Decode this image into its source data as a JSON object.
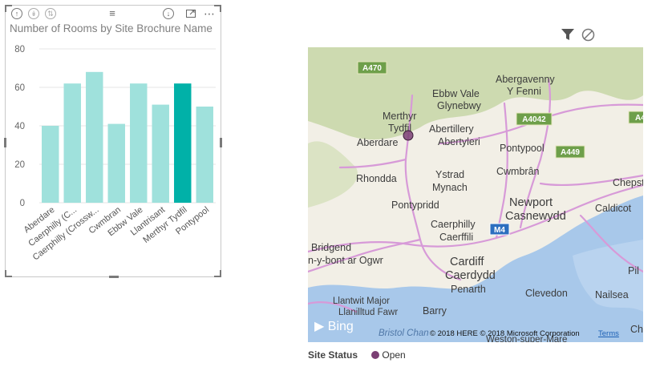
{
  "left_visual": {
    "toolbar_icons": [
      "drill-up-icon",
      "drill-down-all-icon",
      "expand-hierarchy-icon",
      "drag-handle-icon",
      "drill-mode-icon",
      "focus-mode-icon",
      "more-options-icon"
    ],
    "title": "Number of Rooms by Site Brochure Name"
  },
  "chart_data": {
    "type": "bar",
    "title": "Number of Rooms by Site Brochure Name",
    "categories": [
      "Aberdare",
      "Caerphilly (C...",
      "Caerphilly (Crossw...",
      "Cwmbran",
      "Ebbw Vale",
      "Llantrisant",
      "Merthyr Tydfil",
      "Pontypool"
    ],
    "values": [
      40,
      62,
      68,
      41,
      62,
      51,
      62,
      50
    ],
    "highlighted_index": 6,
    "ylim": [
      0,
      80
    ],
    "yticks": [
      0,
      20,
      40,
      60,
      80
    ],
    "grid": true,
    "colors": {
      "bar": "#9fe1dc",
      "highlight": "#01b1a8"
    }
  },
  "map_visual": {
    "header_icons": [
      "filter-icon",
      "blocked-icon"
    ],
    "labels": {
      "a470": "A470",
      "abergavenny": "Abergavenny",
      "y_fenni": "Y Fenni",
      "ebbw_vale": "Ebbw Vale",
      "glynebwy": "Glynebwy",
      "merthyr": "Merthyr",
      "tydfil": "Tydfil",
      "a4042": "A4042",
      "abertillery": "Abertillery",
      "abertyleri": "Abertyleri",
      "aberdare": "Aberdare",
      "pontypool": "Pontypool",
      "a449": "A449",
      "a4_partial": "A4",
      "rhondda": "Rhondda",
      "ystrad": "Ystrad",
      "mynach": "Mynach",
      "cwmbran": "Cwmbrân",
      "chepst": "Chepst",
      "newport": "Newport",
      "casnewydd": "Casnewydd",
      "pontypridd": "Pontypridd",
      "caldicot": "Caldicot",
      "caerphilly": "Caerphilly",
      "caerffili": "Caerffili",
      "m4": "M4",
      "bridgend": "Bridgend",
      "pen_y_bont": "n-y-bont ar Ogwr",
      "cardiff": "Cardiff",
      "caerdydd": "Caerdydd",
      "pil": "Pil",
      "penarth": "Penarth",
      "llantwit": "Llantwit Major",
      "llanilltud": "Llanilltud Fawr",
      "clevedon": "Clevedon",
      "nailsea": "Nailsea",
      "barry": "Barry",
      "bristol_chan": "Bristol Chan",
      "weston": "Weston-super-Mare",
      "che": "Che"
    },
    "bing": "Bing",
    "copyright": "© 2018 HERE © 2018 Microsoft Corporation",
    "terms": "Terms",
    "colors": {
      "land": "#f2efe6",
      "hills": "#cfdcb0",
      "water": "#a8c8ea",
      "road": "#d79ad8",
      "pin": "#7b3f74"
    }
  },
  "legend": {
    "title": "Site Status",
    "items": [
      "Open"
    ]
  }
}
